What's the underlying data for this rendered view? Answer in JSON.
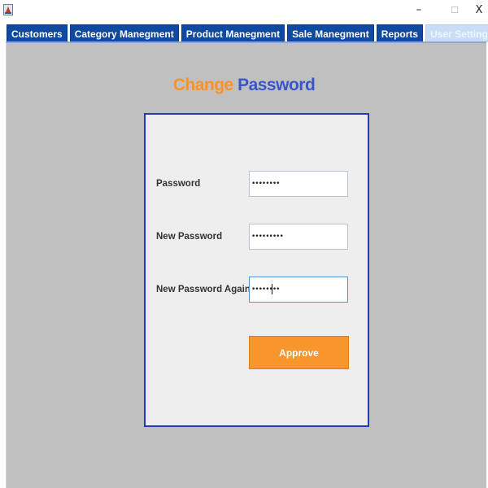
{
  "window": {
    "icon": "java-app-icon",
    "minimize_glyph": "–",
    "maximize_glyph": "☐",
    "close_glyph": "X"
  },
  "tabs": [
    {
      "label": "Customers",
      "active": false
    },
    {
      "label": "Category Manegment",
      "active": false
    },
    {
      "label": "Product Manegment",
      "active": false
    },
    {
      "label": "Sale Manegment",
      "active": false
    },
    {
      "label": "Reports",
      "active": false
    },
    {
      "label": "User Settings",
      "active": true
    }
  ],
  "heading": {
    "word1": "Change",
    "word2": "Password",
    "color1": "#f7922c",
    "color2": "#3a55c8"
  },
  "form": {
    "password": {
      "label": "Password",
      "value": "••••••••",
      "focused": false
    },
    "new_password": {
      "label": "New Password",
      "value": "•••••••••",
      "focused": false
    },
    "new_password_again": {
      "label": "New Password Again",
      "value": "••••••••",
      "focused": true
    },
    "approve_label": "Approve"
  },
  "colors": {
    "tab_bg": "#0f49a0",
    "panel_bg": "#c0c0c0",
    "card_bg": "#eeeeee",
    "card_border": "#1e3bc0",
    "button_bg": "#f7962c"
  }
}
